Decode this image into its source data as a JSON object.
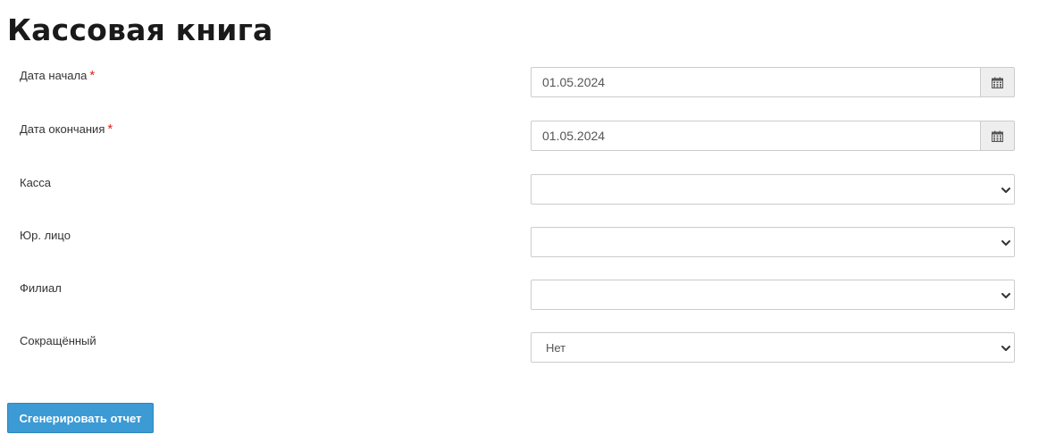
{
  "page": {
    "title": "Кассовая книга"
  },
  "form": {
    "date_start": {
      "label": "Дата начала",
      "required_mark": "*",
      "value": "01.05.2024"
    },
    "date_end": {
      "label": "Дата окончания",
      "required_mark": "*",
      "value": "01.05.2024"
    },
    "cashbox": {
      "label": "Касса",
      "value": ""
    },
    "legal_entity": {
      "label": "Юр. лицо",
      "value": ""
    },
    "branch": {
      "label": "Филиал",
      "value": ""
    },
    "abbreviated": {
      "label": "Сокращённый",
      "value": "Нет"
    }
  },
  "actions": {
    "generate_label": "Сгенерировать отчет"
  },
  "icons": {
    "calendar": "calendar-icon",
    "dropdown": "chevron-down-icon"
  },
  "colors": {
    "primary_button": "#3c9ad4",
    "required_star": "#d9251c",
    "input_border": "#cccccc",
    "addon_background": "#eeeeee"
  }
}
